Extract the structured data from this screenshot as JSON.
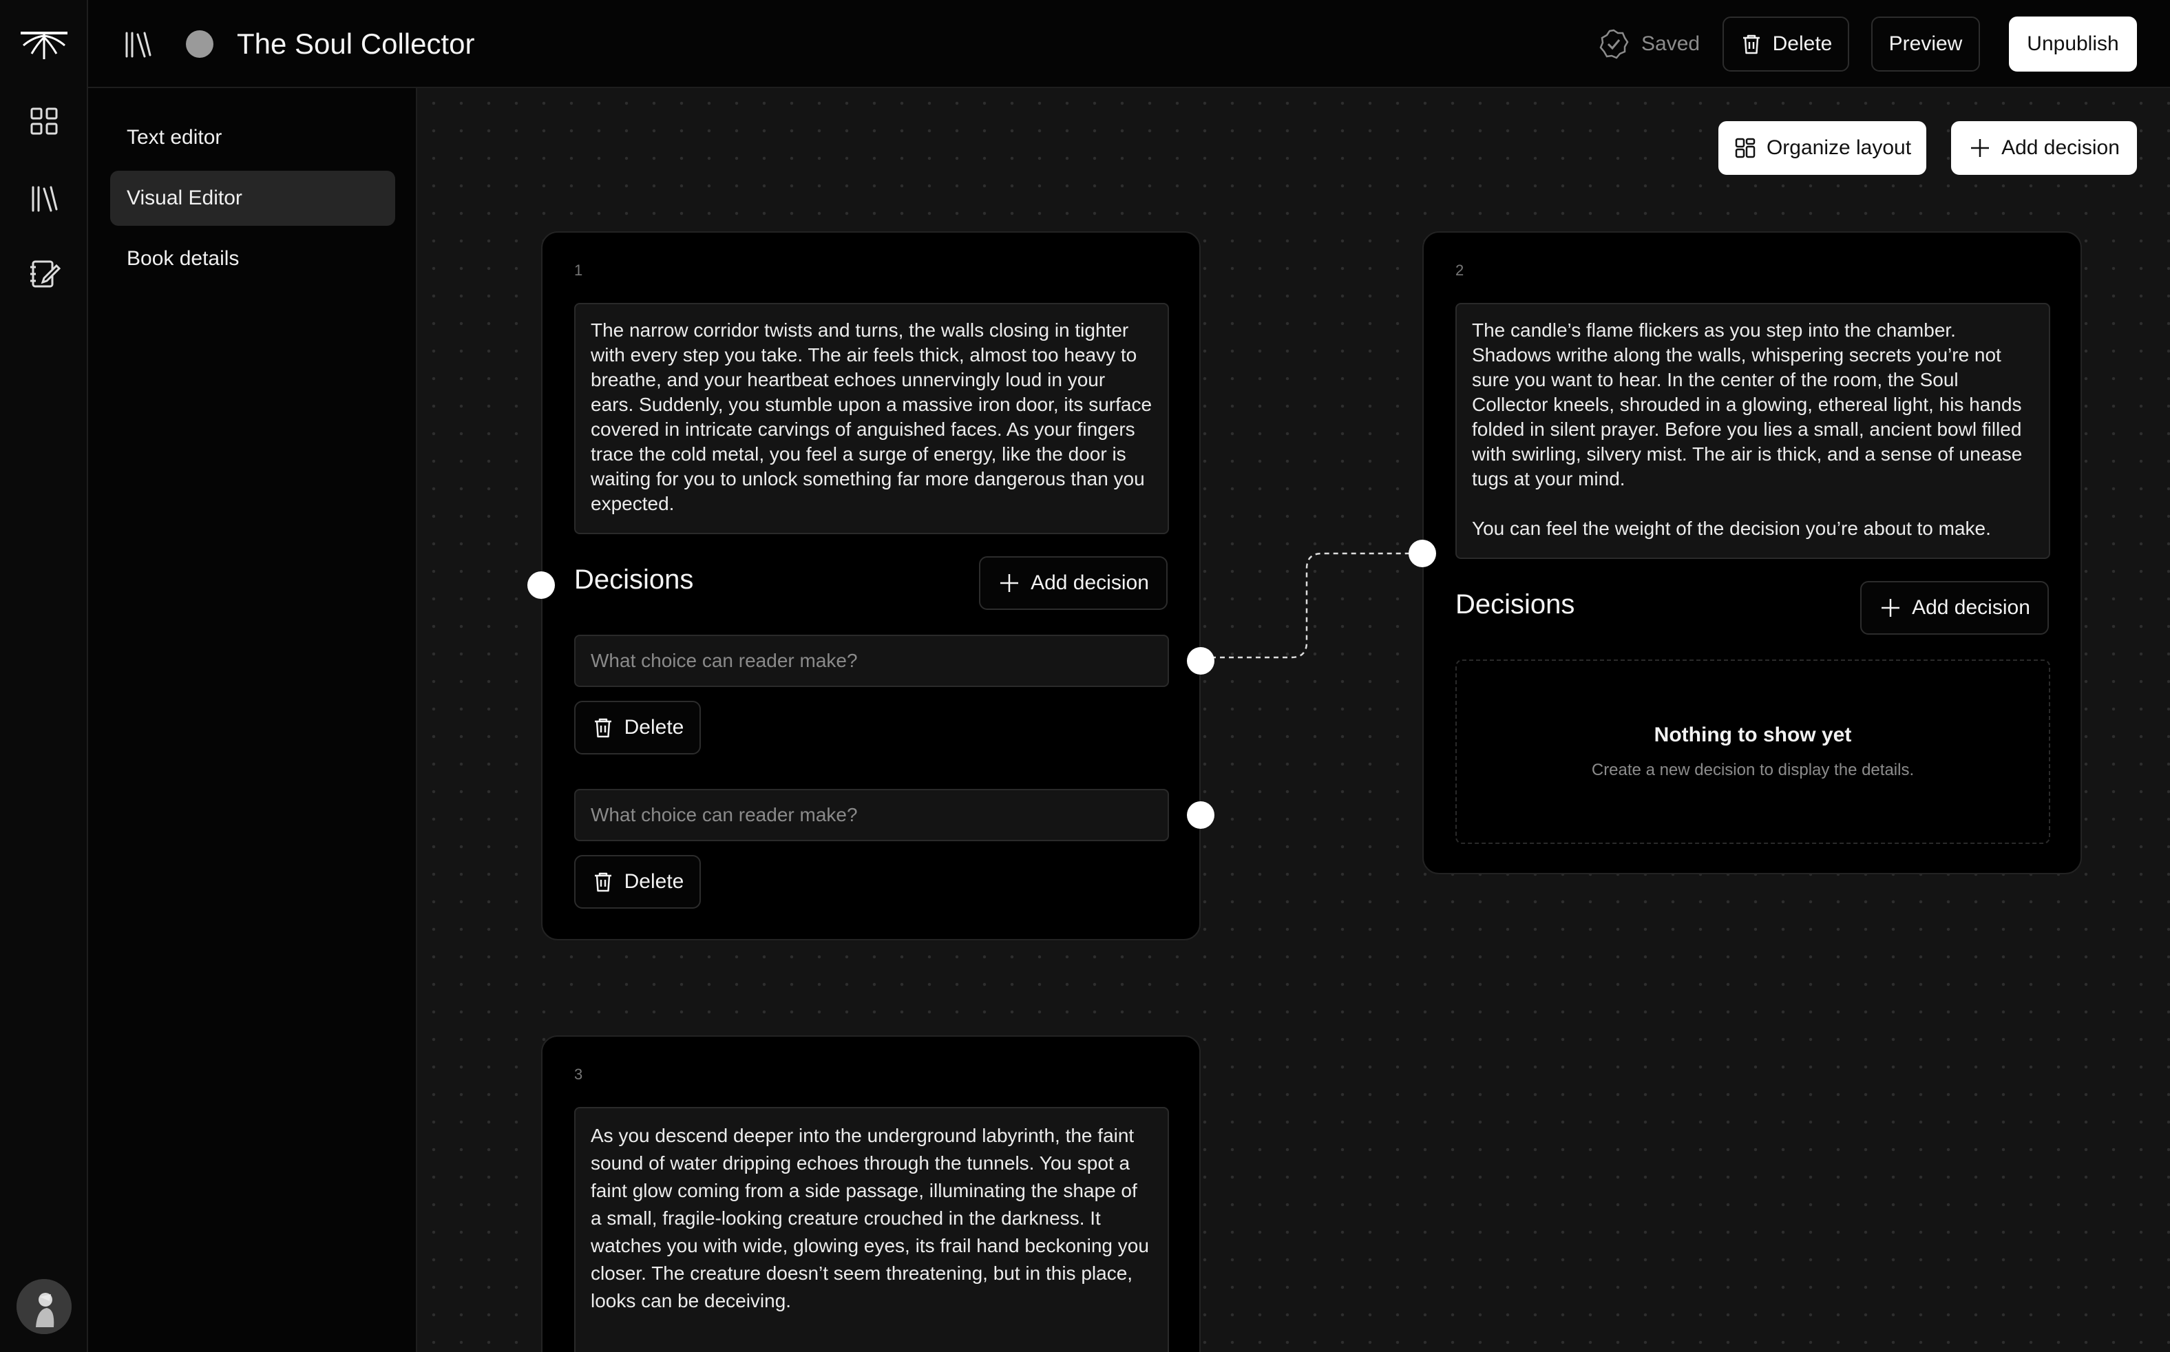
{
  "header": {
    "book_title": "The Soul Collector",
    "saved_label": "Saved",
    "delete_label": "Delete",
    "preview_label": "Preview",
    "unpublish_label": "Unpublish"
  },
  "rail": {
    "icons": [
      "logo-icon",
      "grid-icon",
      "library-icon",
      "notebook-icon"
    ]
  },
  "sidenav": {
    "items": [
      {
        "label": "Text editor",
        "active": false
      },
      {
        "label": "Visual Editor",
        "active": true
      },
      {
        "label": "Book details",
        "active": false
      }
    ]
  },
  "toolbar": {
    "organize_label": "Organize layout",
    "add_decision_label": "Add decision"
  },
  "nodes": [
    {
      "number": "1",
      "text": "The narrow corridor twists and turns, the walls closing in tighter with every step you take. The air feels thick, almost too heavy to breathe, and your heartbeat echoes unnervingly loud in your ears. Suddenly, you stumble upon a massive iron door, its surface covered in intricate carvings of anguished faces. As your fingers trace the cold metal, you feel a surge of energy, like the door is waiting for you to unlock something far more dangerous than you expected.",
      "decisions_title": "Decisions",
      "add_decision_label": "Add decision",
      "choices": [
        {
          "placeholder": "What choice can reader make?",
          "delete_label": "Delete"
        },
        {
          "placeholder": "What choice can reader make?",
          "delete_label": "Delete"
        }
      ]
    },
    {
      "number": "2",
      "text": "The candle’s flame flickers as you step into the chamber. Shadows writhe along the walls, whispering secrets you’re not sure you want to hear. In the center of the room, the Soul Collector kneels, shrouded in a glowing, ethereal light, his hands folded in silent prayer. Before you lies a small, ancient bowl filled with swirling, silvery mist. The air is thick, and a sense of unease tugs at your mind.\n\nYou can feel the weight of the decision you’re about to make.",
      "decisions_title": "Decisions",
      "add_decision_label": "Add decision",
      "empty_title": "Nothing to show yet",
      "empty_subtitle": "Create a new decision to display the details."
    },
    {
      "number": "3",
      "text": "As you descend deeper into the underground labyrinth, the faint sound of water dripping echoes through the tunnels. You spot a faint glow coming from a side passage, illuminating the shape of a small, fragile-looking creature crouched in the darkness. It watches you with wide, glowing eyes, its frail hand beckoning you closer. The creature doesn’t seem threatening, but in this place, looks can be deceiving."
    }
  ],
  "colors": {
    "canvas_bg": "#141414",
    "card_bg": "#000000",
    "accent_light": "#ffffff"
  }
}
